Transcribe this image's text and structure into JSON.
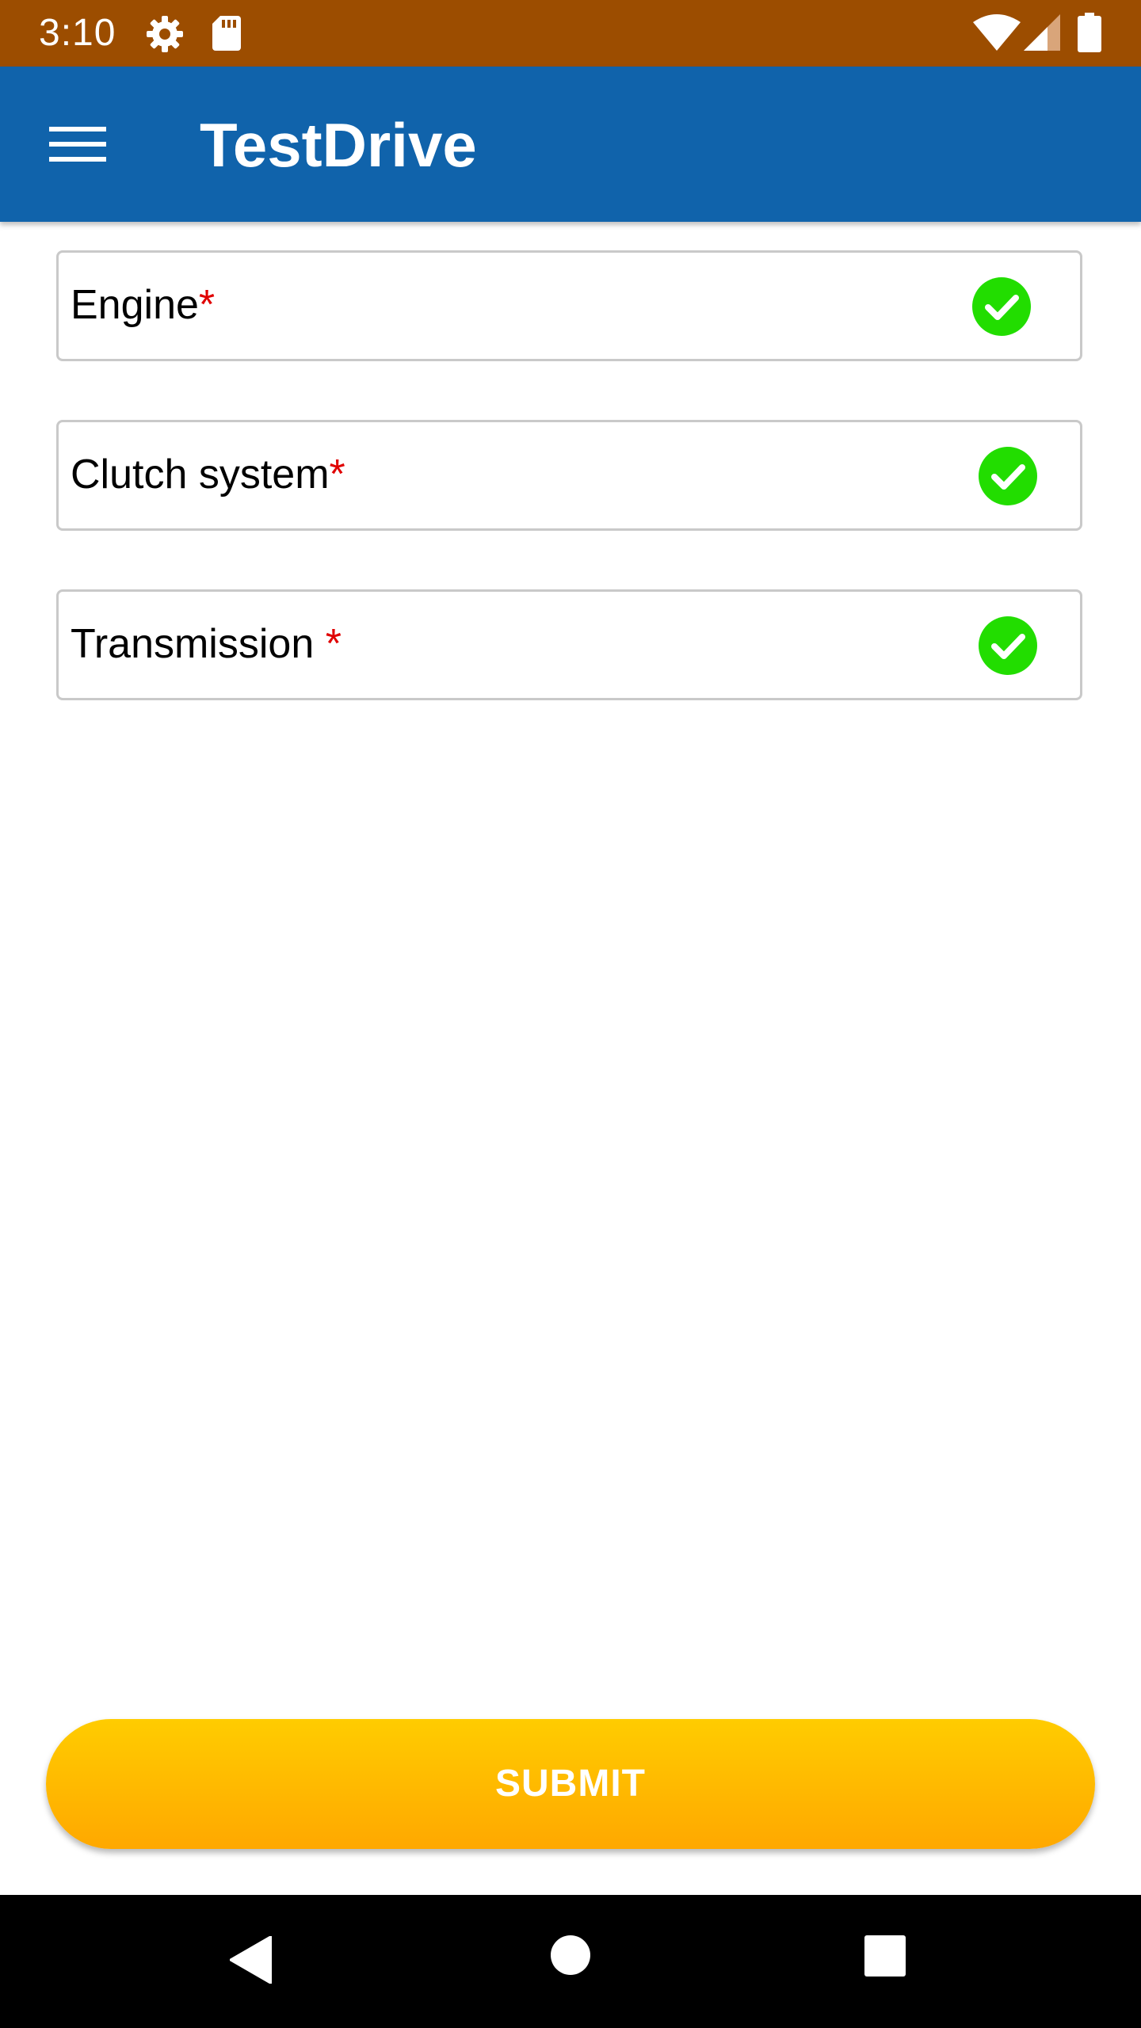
{
  "status_bar": {
    "time": "3:10",
    "icons": [
      "gear-icon",
      "sd-card-icon",
      "wifi-icon",
      "signal-icon",
      "battery-icon"
    ]
  },
  "app_bar": {
    "title": "TestDrive",
    "menu_icon": "hamburger-menu-icon"
  },
  "fields": [
    {
      "label": "Engine",
      "required_mark": "*",
      "status_icon": "check-circle-icon",
      "status": "checked"
    },
    {
      "label": "Clutch system",
      "required_mark": "*",
      "status_icon": "check-circle-icon",
      "status": "checked"
    },
    {
      "label": "Transmission ",
      "required_mark": "*",
      "status_icon": "check-circle-icon",
      "status": "checked"
    }
  ],
  "submit": {
    "label": "SUBMIT"
  },
  "nav_bar": {
    "icons": [
      "back-icon",
      "home-icon",
      "recents-icon"
    ]
  },
  "colors": {
    "status_bar": "#9c4d00",
    "app_bar": "#1063ab",
    "check_green": "#22dd00",
    "required_red": "#e00000",
    "submit_top": "#ffcc00",
    "submit_bottom": "#ffa800"
  }
}
